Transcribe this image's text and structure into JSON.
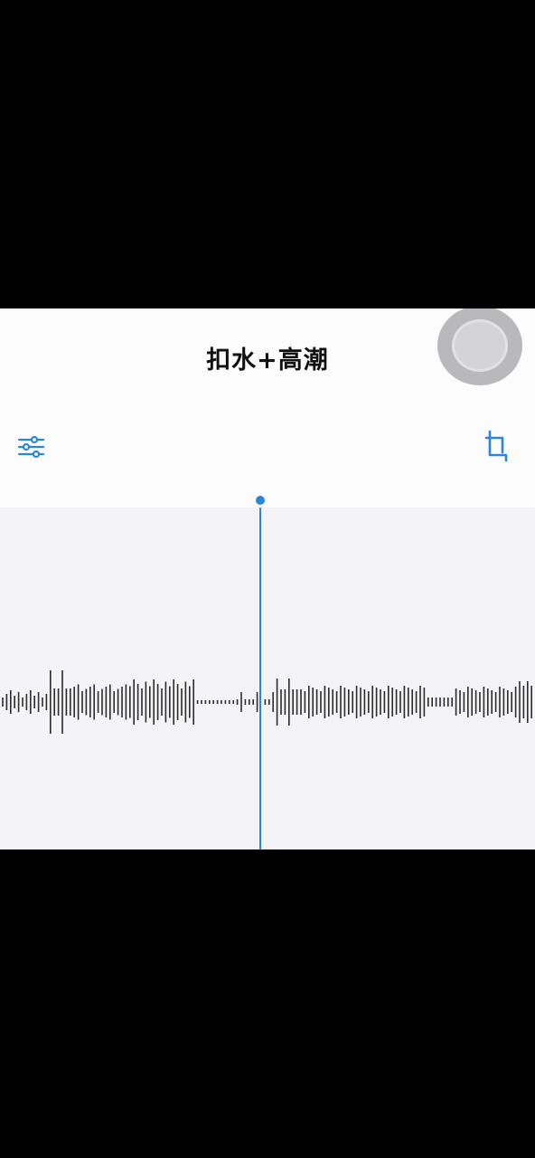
{
  "header": {
    "title": "扣水+高潮"
  },
  "toolbar": {
    "filter_icon": "sliders-icon",
    "crop_icon": "crop-icon"
  },
  "colors": {
    "accent": "#2a86d8",
    "wave": "#2b2b2b",
    "background": "#fdfcfd",
    "waveform_bg": "#f4f3f5"
  },
  "playback": {
    "playhead_fraction": 0.487
  }
}
